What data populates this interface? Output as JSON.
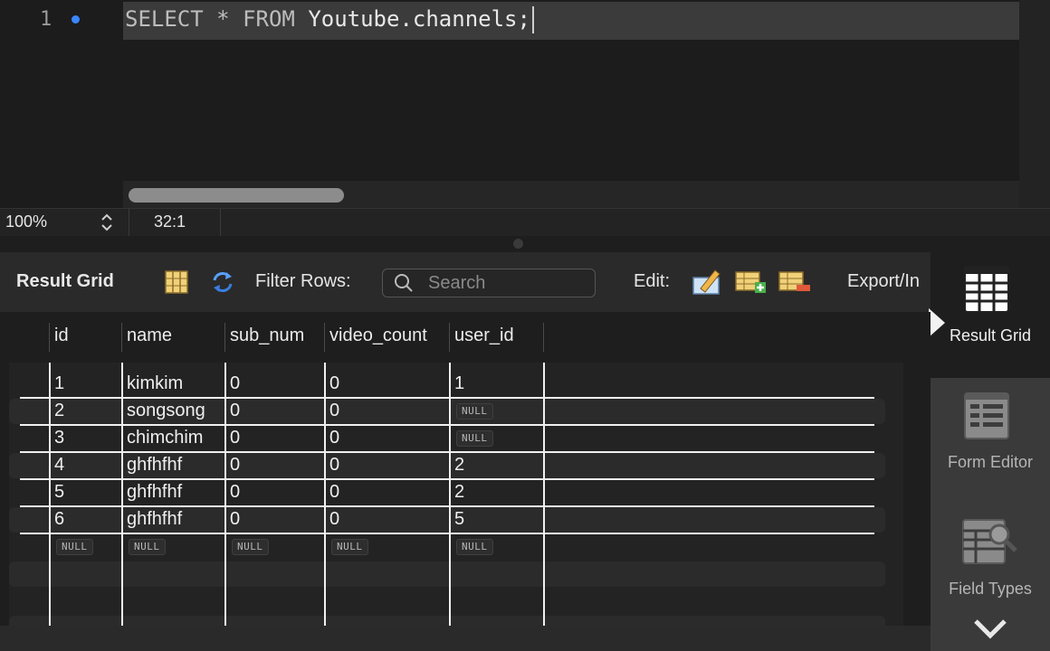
{
  "editor": {
    "line_number": "1",
    "code": {
      "kw_select": "SELECT",
      "star": "*",
      "kw_from": "FROM",
      "table": "Youtube.channels;"
    }
  },
  "statusbar": {
    "zoom": "100%",
    "position": "32:1"
  },
  "toolbar": {
    "title": "Result Grid",
    "filter_label": "Filter Rows:",
    "search_placeholder": "Search",
    "edit_label": "Edit:",
    "export_label": "Export/In"
  },
  "sidebar": {
    "result_grid": "Result Grid",
    "form_editor": "Form Editor",
    "field_types": "Field Types"
  },
  "grid": {
    "columns": [
      "id",
      "name",
      "sub_num",
      "video_count",
      "user_id"
    ],
    "null_text": "NULL",
    "rows": [
      [
        "1",
        "kimkim",
        "0",
        "0",
        "1"
      ],
      [
        "2",
        "songsong",
        "0",
        "0",
        "NULL"
      ],
      [
        "3",
        "chimchim",
        "0",
        "0",
        "NULL"
      ],
      [
        "4",
        "ghfhfhf",
        "0",
        "0",
        "2"
      ],
      [
        "5",
        "ghfhfhf",
        "0",
        "0",
        "2"
      ],
      [
        "6",
        "ghfhfhf",
        "0",
        "0",
        "5"
      ],
      [
        "NULL",
        "NULL",
        "NULL",
        "NULL",
        "NULL"
      ]
    ]
  },
  "colors": {
    "accent_blue": "#3a86ff",
    "background": "#1e1e1e",
    "sidebar_bg": "#3a3a3a"
  }
}
